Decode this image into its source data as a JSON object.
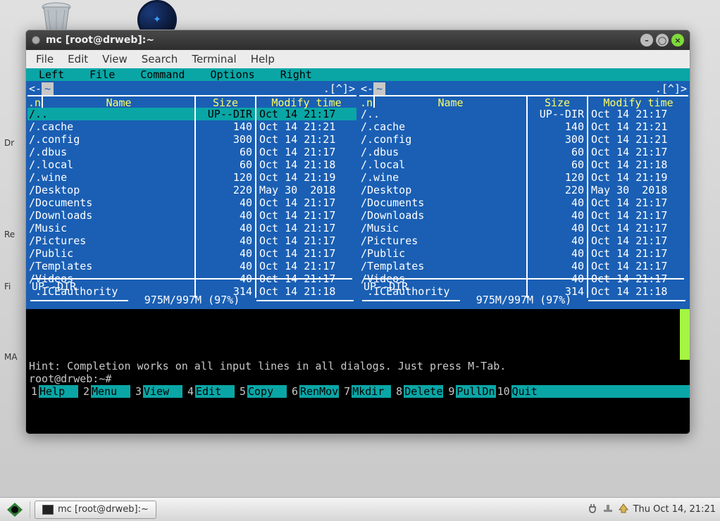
{
  "window": {
    "title": "mc [root@drweb]:~",
    "menubar": [
      "File",
      "Edit",
      "View",
      "Search",
      "Terminal",
      "Help"
    ]
  },
  "mc": {
    "topmenu": [
      "Left",
      "File",
      "Command",
      "Options",
      "Right"
    ],
    "header": {
      "n": ".n",
      "name": "Name",
      "size": "Size",
      "modify": "Modify time"
    },
    "left": {
      "path": "~",
      "rows": [
        {
          "name": "/..",
          "size": "UP--DIR",
          "mod": "Oct 14 21:17",
          "sel": true
        },
        {
          "name": "/.cache",
          "size": "140",
          "mod": "Oct 14 21:21"
        },
        {
          "name": "/.config",
          "size": "300",
          "mod": "Oct 14 21:21"
        },
        {
          "name": "/.dbus",
          "size": "60",
          "mod": "Oct 14 21:17"
        },
        {
          "name": "/.local",
          "size": "60",
          "mod": "Oct 14 21:18"
        },
        {
          "name": "/.wine",
          "size": "120",
          "mod": "Oct 14 21:19"
        },
        {
          "name": "/Desktop",
          "size": "220",
          "mod": "May 30  2018"
        },
        {
          "name": "/Documents",
          "size": "40",
          "mod": "Oct 14 21:17"
        },
        {
          "name": "/Downloads",
          "size": "40",
          "mod": "Oct 14 21:17"
        },
        {
          "name": "/Music",
          "size": "40",
          "mod": "Oct 14 21:17"
        },
        {
          "name": "/Pictures",
          "size": "40",
          "mod": "Oct 14 21:17"
        },
        {
          "name": "/Public",
          "size": "40",
          "mod": "Oct 14 21:17"
        },
        {
          "name": "/Templates",
          "size": "40",
          "mod": "Oct 14 21:17"
        },
        {
          "name": "/Videos",
          "size": "40",
          "mod": "Oct 14 21:17"
        },
        {
          "name": " .ICEauthority",
          "size": "314",
          "mod": "Oct 14 21:18"
        }
      ],
      "footinfo": "UP--DIR",
      "usage": "975M/997M (97%)"
    },
    "right": {
      "path": "~",
      "rows": [
        {
          "name": "/..",
          "size": "UP--DIR",
          "mod": "Oct 14 21:17"
        },
        {
          "name": "/.cache",
          "size": "140",
          "mod": "Oct 14 21:21"
        },
        {
          "name": "/.config",
          "size": "300",
          "mod": "Oct 14 21:21"
        },
        {
          "name": "/.dbus",
          "size": "60",
          "mod": "Oct 14 21:17"
        },
        {
          "name": "/.local",
          "size": "60",
          "mod": "Oct 14 21:18"
        },
        {
          "name": "/.wine",
          "size": "120",
          "mod": "Oct 14 21:19"
        },
        {
          "name": "/Desktop",
          "size": "220",
          "mod": "May 30  2018"
        },
        {
          "name": "/Documents",
          "size": "40",
          "mod": "Oct 14 21:17"
        },
        {
          "name": "/Downloads",
          "size": "40",
          "mod": "Oct 14 21:17"
        },
        {
          "name": "/Music",
          "size": "40",
          "mod": "Oct 14 21:17"
        },
        {
          "name": "/Pictures",
          "size": "40",
          "mod": "Oct 14 21:17"
        },
        {
          "name": "/Public",
          "size": "40",
          "mod": "Oct 14 21:17"
        },
        {
          "name": "/Templates",
          "size": "40",
          "mod": "Oct 14 21:17"
        },
        {
          "name": "/Videos",
          "size": "40",
          "mod": "Oct 14 21:17"
        },
        {
          "name": " .ICEauthority",
          "size": "314",
          "mod": "Oct 14 21:18"
        }
      ],
      "footinfo": "UP--DIR",
      "usage": "975M/997M (97%)"
    },
    "hint": "Hint: Completion works on all input lines in all dialogs. Just press M-Tab.",
    "prompt": "root@drweb:~#",
    "fkeys": [
      {
        "n": "1",
        "l": "Help"
      },
      {
        "n": "2",
        "l": "Menu"
      },
      {
        "n": "3",
        "l": "View"
      },
      {
        "n": "4",
        "l": "Edit"
      },
      {
        "n": "5",
        "l": "Copy"
      },
      {
        "n": "6",
        "l": "RenMov"
      },
      {
        "n": "7",
        "l": "Mkdir"
      },
      {
        "n": "8",
        "l": "Delete"
      },
      {
        "n": "9",
        "l": "PullDn"
      },
      {
        "n": "10",
        "l": "Quit"
      }
    ]
  },
  "desktop": {
    "labels": {
      "dr": "Dr",
      "re": "Re",
      "fi": "Fi",
      "ma": "MA"
    }
  },
  "taskbar": {
    "task": "mc [root@drweb]:~",
    "clock": "Thu Oct 14, 21:21"
  }
}
